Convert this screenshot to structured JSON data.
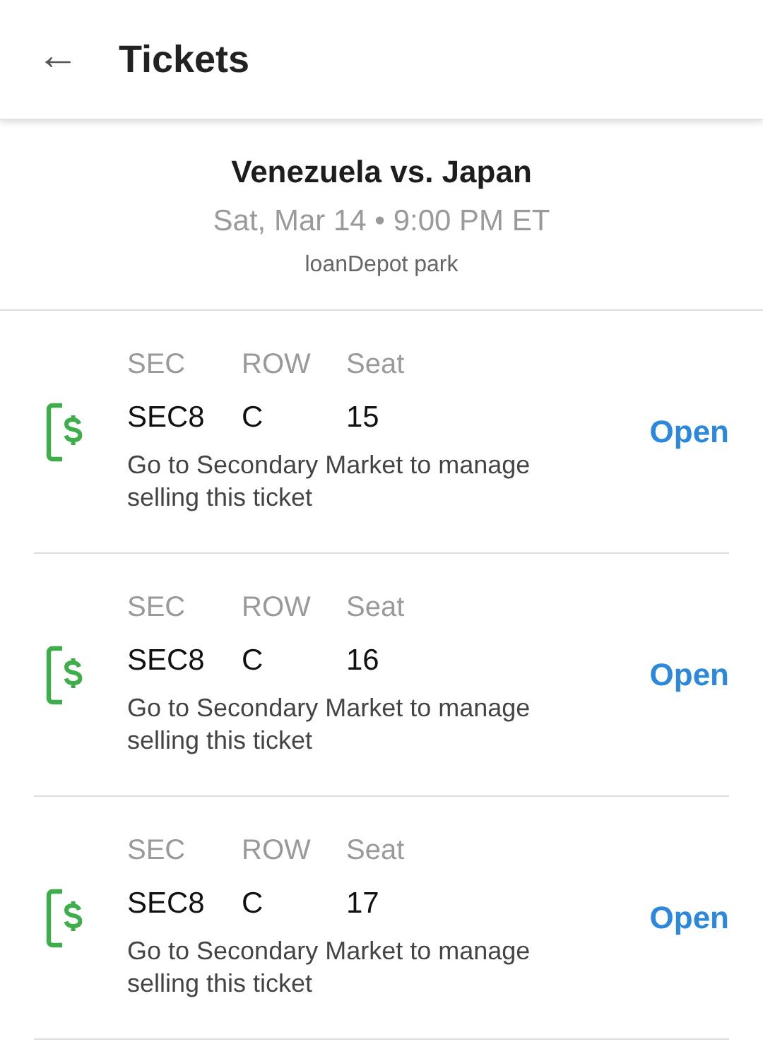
{
  "app_bar": {
    "back": "←",
    "title": "Tickets"
  },
  "event": {
    "title": "Venezuela vs. Japan",
    "datetime": "Sat, Mar 14 • 9:00 PM ET",
    "venue": "loanDepot park"
  },
  "tickets": [
    {
      "labels": [
        "SEC",
        "ROW",
        "Seat"
      ],
      "values": [
        "SEC8",
        "C",
        "15"
      ],
      "note": "Go to Secondary Market to manage selling this ticket",
      "action": "Open"
    },
    {
      "labels": [
        "SEC",
        "ROW",
        "Seat"
      ],
      "values": [
        "SEC8",
        "C",
        "16"
      ],
      "note": "Go to Secondary Market to manage selling this ticket",
      "action": "Open"
    },
    {
      "labels": [
        "SEC",
        "ROW",
        "Seat"
      ],
      "values": [
        "SEC8",
        "C",
        "17"
      ],
      "note": "Go to Secondary Market to manage selling this ticket",
      "action": "Open"
    }
  ]
}
